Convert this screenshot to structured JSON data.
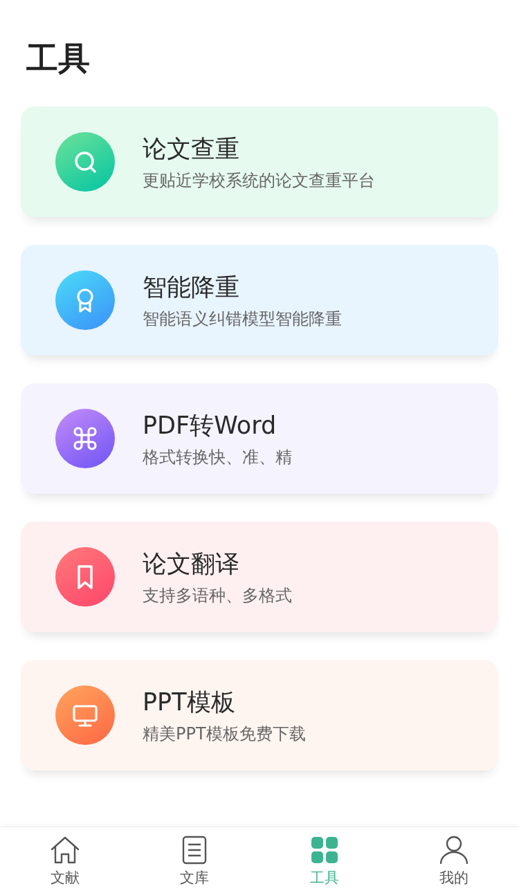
{
  "title": "工具",
  "tools": [
    {
      "kind": "search",
      "title": "论文查重",
      "subtitle": "更贴近学校系统的论文查重平台"
    },
    {
      "kind": "award",
      "title": "智能降重",
      "subtitle": "智能语义纠错模型智能降重"
    },
    {
      "kind": "command",
      "title": "PDF转Word",
      "subtitle": "格式转换快、准、精"
    },
    {
      "kind": "bookmark",
      "title": "论文翻译",
      "subtitle": "支持多语种、多格式"
    },
    {
      "kind": "monitor",
      "title": "PPT模板",
      "subtitle": "精美PPT模板免费下载"
    }
  ],
  "nav": [
    {
      "kind": "home",
      "label": "文献",
      "selected": false
    },
    {
      "kind": "doc",
      "label": "文库",
      "selected": false
    },
    {
      "kind": "grid",
      "label": "工具",
      "selected": true
    },
    {
      "kind": "user",
      "label": "我的",
      "selected": false
    }
  ]
}
